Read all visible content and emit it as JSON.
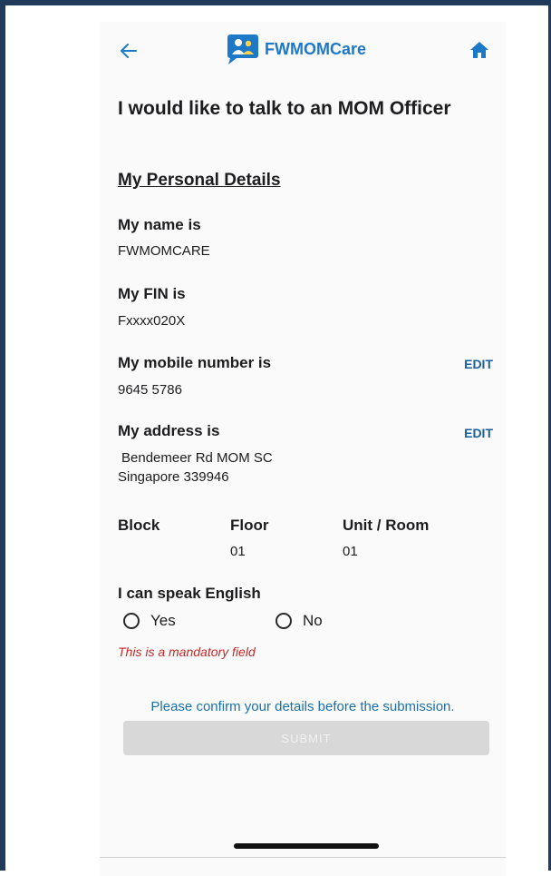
{
  "header": {
    "app_name": "FWMOMCare",
    "back_icon": "arrow-left-icon",
    "home_icon": "home-icon",
    "accent_color": "#1e78c8"
  },
  "page": {
    "title": "I would like to talk to an MOM Officer",
    "section_title": "My Personal Details"
  },
  "details": {
    "name_label": "My name is",
    "name_value": "FWMOMCARE",
    "fin_label": "My FIN is",
    "fin_value": "Fxxxx020X",
    "mobile_label": "My mobile number is",
    "mobile_value": "9645 5786",
    "mobile_edit": "EDIT",
    "address_label": "My address is",
    "address_line1": "Bendemeer Rd MOM SC",
    "address_line2": "Singapore 339946",
    "address_edit": "EDIT"
  },
  "unit_table": {
    "headers": [
      "Block",
      "Floor",
      "Unit / Room"
    ],
    "values": [
      "",
      "01",
      "01"
    ]
  },
  "language": {
    "question": "I can speak English",
    "options": [
      "Yes",
      "No"
    ],
    "selected": null,
    "error": "This is a mandatory field"
  },
  "footer": {
    "confirm_text": "Please confirm your details before the submission.",
    "submit_label": "SUBMIT",
    "submit_enabled": false
  }
}
